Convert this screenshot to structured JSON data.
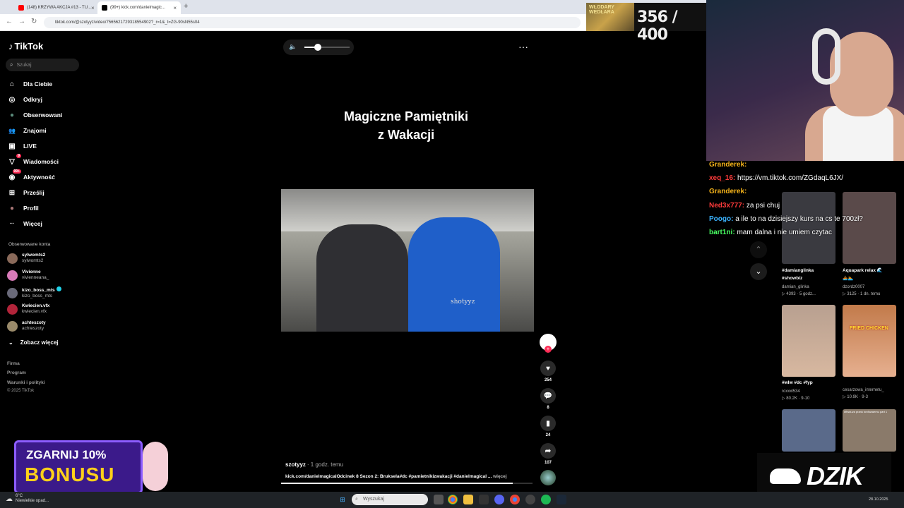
{
  "browser": {
    "tabs": [
      {
        "title": "(148) KRZYWA AKCJA #13 - TU...",
        "color": "#ff0000"
      },
      {
        "title": "(99+) kick.com/danielmagic...",
        "color": "#000000"
      }
    ],
    "new_tab": "+",
    "url": "tiktok.com/@szotyyz/video/7565621729318554902?_r=1&_t=ZG-90sN55s04"
  },
  "stream": {
    "sub_label": "WŁODARY WEDŁARA",
    "sub_counter": "356 / 400",
    "chat": [
      {
        "user": "Granderek:",
        "msg": "",
        "color": "#f5b31a"
      },
      {
        "user": "xeq_16:",
        "msg": "https://vm.tiktok.com/ZGdaqL6JX/",
        "color": "#ff3b3b"
      },
      {
        "user": "Granderek:",
        "msg": "",
        "color": "#f5b31a"
      },
      {
        "user": "Ned3x777:",
        "msg": "za psi chuj",
        "color": "#ff3b3b"
      },
      {
        "user": "Poogo:",
        "msg": "a ile to na dzisiejszy kurs na cs te 700zł?",
        "color": "#3bb3ff"
      },
      {
        "user": "bart1ni:",
        "msg": "mam dalna i nie umiem czytac",
        "color": "#48ff62"
      }
    ],
    "bonus_top": "ZGARNIJ 10%",
    "bonus_main": "BONUSU",
    "brand": "DZIK"
  },
  "tiktok": {
    "logo": "TikTok",
    "search_placeholder": "Szukaj",
    "nav": [
      {
        "label": "Dla Ciebie",
        "icon": "⌂"
      },
      {
        "label": "Odkryj",
        "icon": "◎"
      },
      {
        "label": "Obserwowani",
        "icon": "●"
      },
      {
        "label": "Znajomi",
        "icon": "👥"
      },
      {
        "label": "LIVE",
        "icon": "▣"
      },
      {
        "label": "Wiadomości",
        "icon": "▽",
        "badge": "9"
      },
      {
        "label": "Aktywność",
        "icon": "◉",
        "badge": "99+"
      },
      {
        "label": "Prześlij",
        "icon": "⊞"
      },
      {
        "label": "Profil",
        "icon": "●"
      },
      {
        "label": "Więcej",
        "icon": "···"
      }
    ],
    "followed_title": "Obserwowane konta",
    "followed": [
      {
        "name": "sylwomts2",
        "handle": "sylwomts2",
        "color": "#8a6a5a"
      },
      {
        "name": "Vivienne",
        "handle": "vivienneana_",
        "color": "#d87ab8"
      },
      {
        "name": "kizo_boss_mts",
        "handle": "kizo_boss_mts",
        "color": "#6a6a7a",
        "verified": true
      },
      {
        "name": "Kwiecien.vfx",
        "handle": "kwiecien.vfx",
        "color": "#b2243a"
      },
      {
        "name": "achteszoty",
        "handle": "achteszoty",
        "color": "#9a8a6a"
      }
    ],
    "see_more": "Zobacz więcej",
    "footer": [
      "Firma",
      "Program",
      "Warunki i polityki",
      "© 2025 TikTok"
    ],
    "video": {
      "title_line1": "Magiczne Pamiętniki",
      "title_line2": "z Wakacji",
      "watermark": "shotyyz",
      "author": "szotyyz",
      "time": "· 1 godz. temu",
      "description": "kick.com/danielmagicalOdcinek 8 Sezon 2: Bruksela#dc #pamietnikizwakacji #danielmagical ...",
      "more": "więcej",
      "volume": 0.3,
      "progress": 0.92
    },
    "actions": {
      "likes": "254",
      "comments": "8",
      "saves": "24",
      "shares": "107"
    },
    "recommended": [
      {
        "caption": "#damianglinka #showbiz",
        "author": "damian_glinka",
        "stats": "▷ 4393 · 5 godz...",
        "color": "#3a3a40"
      },
      {
        "caption": "Aquapark relax 🌊",
        "author": "🚣🏊",
        "stats": "dzordz0007",
        "meta2": "▷ 3125 · 1 dn. temu",
        "color": "#5a4a4a"
      },
      {
        "caption": "#wlw #dc #fyp",
        "author": "roxxxl534",
        "stats": "▷ 80.2K · 9-10",
        "color": "#c6a088"
      },
      {
        "caption": "",
        "author": "cesarzowa_internetu_",
        "stats": "▷ 10.9K · 9-3",
        "overlay": "FRIED CHICKEN",
        "color": "#c27a4a"
      },
      {
        "caption": "",
        "author": "",
        "stats": "",
        "color": "#5a6a8a"
      },
      {
        "caption": "",
        "author": "",
        "stats": "",
        "overlay": "#fiwduva prank tonfowaemu part 1",
        "color": "#8a7a6a"
      }
    ]
  },
  "taskbar": {
    "weather_temp": "6°C",
    "weather_desc": "Niewielkie opad...",
    "search_placeholder": "Wyszukaj",
    "date": "28.10.2025"
  }
}
